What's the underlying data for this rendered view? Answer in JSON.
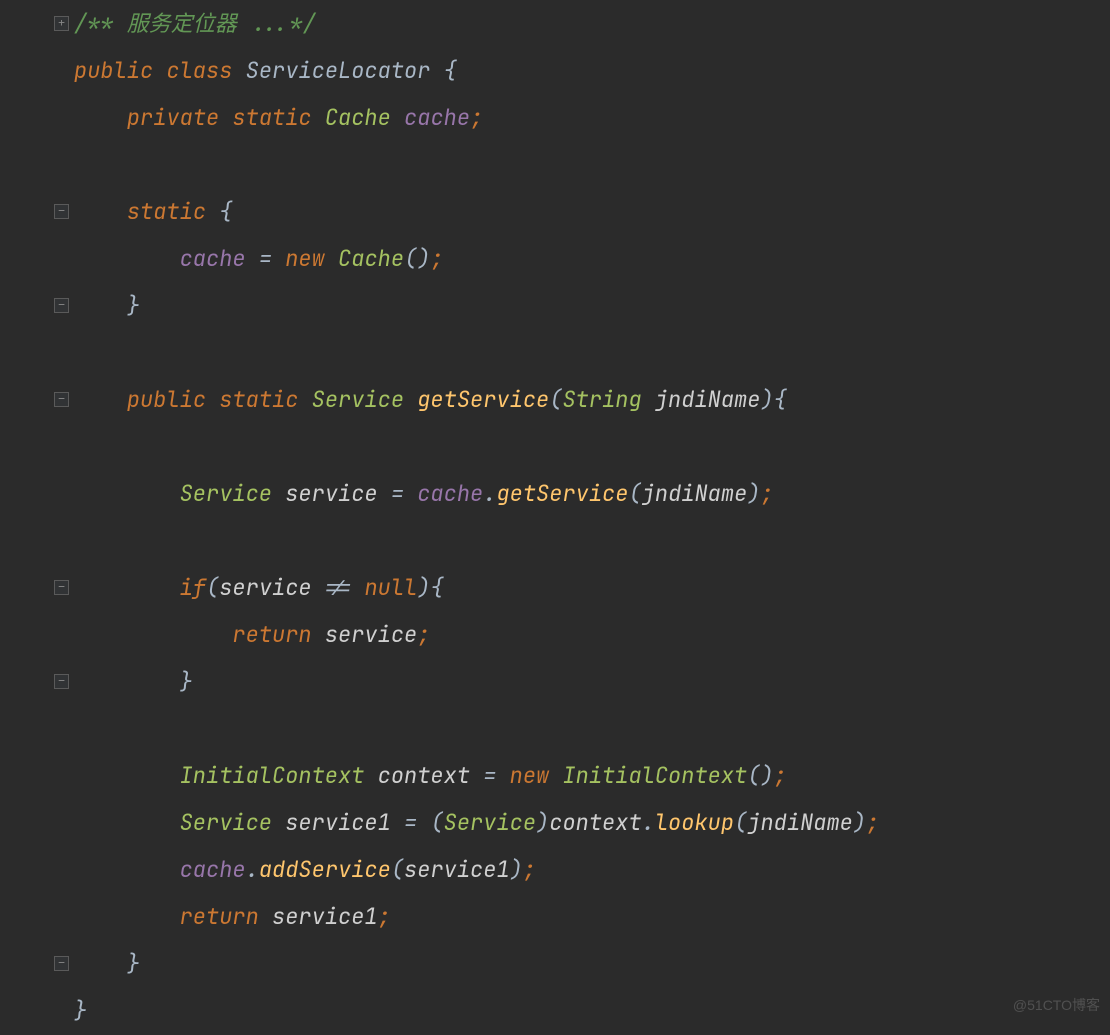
{
  "watermark": "@51CTO博客",
  "folds": [
    {
      "line": 0,
      "kind": "plus"
    },
    {
      "line": 4,
      "kind": "minus"
    },
    {
      "line": 6,
      "kind": "minus"
    },
    {
      "line": 8,
      "kind": "minus"
    },
    {
      "line": 12,
      "kind": "minus"
    },
    {
      "line": 14,
      "kind": "minus"
    },
    {
      "line": 20,
      "kind": "minus"
    }
  ],
  "code": [
    [
      [
        "cmt",
        "/** 服务定位器 ...*/"
      ]
    ],
    [
      [
        "kw",
        "public"
      ],
      [
        "white",
        " "
      ],
      [
        "kw",
        "class"
      ],
      [
        "white",
        " "
      ],
      [
        "white",
        "ServiceLocator "
      ],
      [
        "punc",
        "{"
      ]
    ],
    [
      [
        "white",
        "    "
      ],
      [
        "kw",
        "private"
      ],
      [
        "white",
        " "
      ],
      [
        "kw",
        "static"
      ],
      [
        "white",
        " "
      ],
      [
        "type",
        "Cache"
      ],
      [
        "white",
        " "
      ],
      [
        "field",
        "cache"
      ],
      [
        "semi",
        ";"
      ]
    ],
    [],
    [
      [
        "white",
        "    "
      ],
      [
        "kw",
        "static"
      ],
      [
        "white",
        " "
      ],
      [
        "punc",
        "{"
      ]
    ],
    [
      [
        "white",
        "        "
      ],
      [
        "field",
        "cache"
      ],
      [
        "white",
        " "
      ],
      [
        "punc",
        "="
      ],
      [
        "white",
        " "
      ],
      [
        "kw",
        "new"
      ],
      [
        "white",
        " "
      ],
      [
        "type",
        "Cache"
      ],
      [
        "punc",
        "()"
      ],
      [
        "semi",
        ";"
      ]
    ],
    [
      [
        "white",
        "    "
      ],
      [
        "punc",
        "}"
      ]
    ],
    [],
    [
      [
        "white",
        "    "
      ],
      [
        "kw",
        "public"
      ],
      [
        "white",
        " "
      ],
      [
        "kw",
        "static"
      ],
      [
        "white",
        " "
      ],
      [
        "type",
        "Service"
      ],
      [
        "white",
        " "
      ],
      [
        "ident",
        "getService"
      ],
      [
        "punc",
        "("
      ],
      [
        "type",
        "String"
      ],
      [
        "white",
        " "
      ],
      [
        "param",
        "jndiName"
      ],
      [
        "punc",
        ")"
      ],
      [
        "punc",
        "{"
      ]
    ],
    [],
    [
      [
        "white",
        "        "
      ],
      [
        "type",
        "Service"
      ],
      [
        "white",
        " "
      ],
      [
        "param",
        "service"
      ],
      [
        "white",
        " "
      ],
      [
        "punc",
        "="
      ],
      [
        "white",
        " "
      ],
      [
        "field",
        "cache"
      ],
      [
        "punc",
        "."
      ],
      [
        "ident",
        "getService"
      ],
      [
        "punc",
        "("
      ],
      [
        "param",
        "jndiName"
      ],
      [
        "punc",
        ")"
      ],
      [
        "semi",
        ";"
      ]
    ],
    [],
    [
      [
        "white",
        "        "
      ],
      [
        "kw",
        "if"
      ],
      [
        "punc",
        "("
      ],
      [
        "param",
        "service"
      ],
      [
        "white",
        " "
      ],
      [
        "punc",
        "!="
      ],
      [
        "white",
        " "
      ],
      [
        "const",
        "null"
      ],
      [
        "punc",
        ")"
      ],
      [
        "punc",
        "{"
      ]
    ],
    [
      [
        "white",
        "            "
      ],
      [
        "kw",
        "return"
      ],
      [
        "white",
        " "
      ],
      [
        "param",
        "service"
      ],
      [
        "semi",
        ";"
      ]
    ],
    [
      [
        "white",
        "        "
      ],
      [
        "punc",
        "}"
      ]
    ],
    [],
    [
      [
        "white",
        "        "
      ],
      [
        "type",
        "InitialContext"
      ],
      [
        "white",
        " "
      ],
      [
        "param",
        "context"
      ],
      [
        "white",
        " "
      ],
      [
        "punc",
        "="
      ],
      [
        "white",
        " "
      ],
      [
        "kw",
        "new"
      ],
      [
        "white",
        " "
      ],
      [
        "type",
        "InitialContext"
      ],
      [
        "punc",
        "()"
      ],
      [
        "semi",
        ";"
      ]
    ],
    [
      [
        "white",
        "        "
      ],
      [
        "type",
        "Service"
      ],
      [
        "white",
        " "
      ],
      [
        "param",
        "service1"
      ],
      [
        "white",
        " "
      ],
      [
        "punc",
        "="
      ],
      [
        "white",
        " "
      ],
      [
        "punc",
        "("
      ],
      [
        "type",
        "Service"
      ],
      [
        "punc",
        ")"
      ],
      [
        "param",
        "context"
      ],
      [
        "punc",
        "."
      ],
      [
        "ident",
        "lookup"
      ],
      [
        "punc",
        "("
      ],
      [
        "param",
        "jndiName"
      ],
      [
        "punc",
        ")"
      ],
      [
        "semi",
        ";"
      ]
    ],
    [
      [
        "white",
        "        "
      ],
      [
        "field",
        "cache"
      ],
      [
        "punc",
        "."
      ],
      [
        "ident",
        "addService"
      ],
      [
        "punc",
        "("
      ],
      [
        "param",
        "service1"
      ],
      [
        "punc",
        ")"
      ],
      [
        "semi",
        ";"
      ]
    ],
    [
      [
        "white",
        "        "
      ],
      [
        "kw",
        "return"
      ],
      [
        "white",
        " "
      ],
      [
        "param",
        "service1"
      ],
      [
        "semi",
        ";"
      ]
    ],
    [
      [
        "white",
        "    "
      ],
      [
        "punc",
        "}"
      ]
    ],
    [
      [
        "punc",
        "}"
      ]
    ]
  ]
}
